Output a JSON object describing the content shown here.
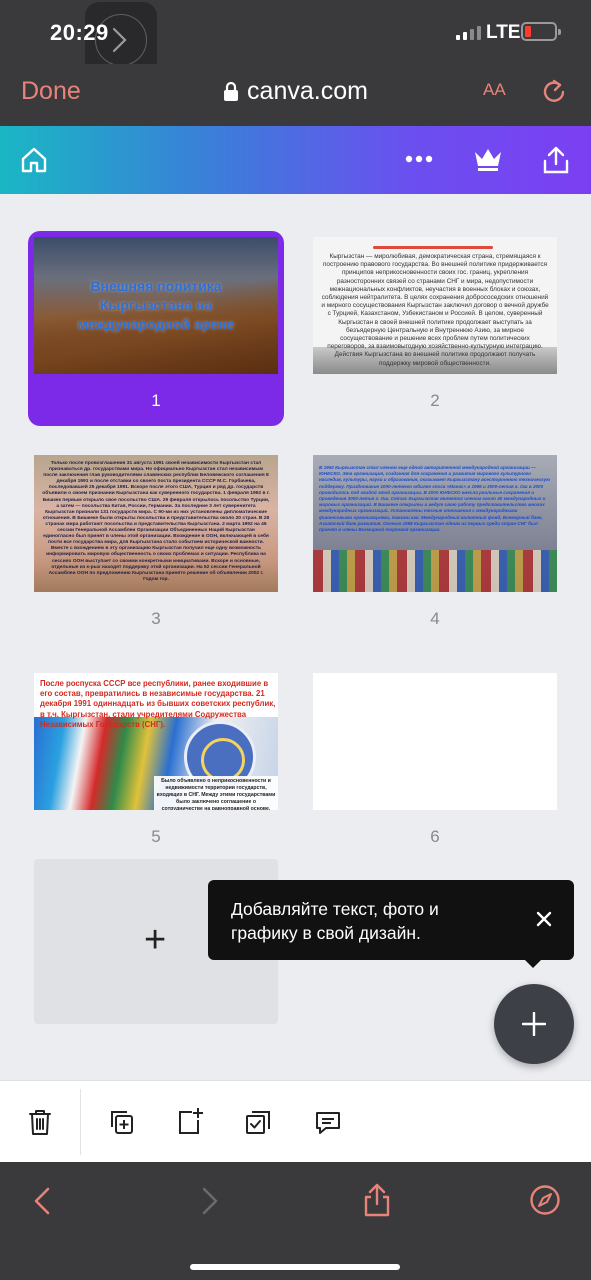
{
  "status_bar": {
    "time": "20:29",
    "network": "LTE"
  },
  "browser": {
    "done_label": "Done",
    "url": "canva.com",
    "text_size_label": "AA"
  },
  "canva_header": {
    "icons": [
      "home-icon",
      "more-icon",
      "crown-icon",
      "share-icon"
    ]
  },
  "pages": [
    {
      "number": "1",
      "selected": true,
      "title": "Внешняя политика Кыргызстана на международной арене"
    },
    {
      "number": "2",
      "selected": false,
      "text": "Кыргызстан — миролюбивая, демократическая страна, стремящаяся к построению правового государства. Во внешней политике придерживается принципов неприкосновенности своих гос. границ, укрепления разносторонних связей со странами СНГ и мира, недопустимости межнациональных конфликтов, неучастия в военных блоках и союзах, соблюдения нейтралитета. В целях сохранения добрососедских отношений и мирного сосуществования Кыргызстан заключил договор о вечной дружбе с Турцией, Казахстаном, Узбекистаном и Россией. В целом, суверенный Кыргызстан в своей внешней политике продолжает выступать за безъядерную Центральную и Внутреннюю Азию, за мирное сосуществование и решение всех проблем путем политических переговоров, за взаимовыгодную хозяйственно-культурную интеграцию. Действия Кыргызстана во внешней политике продолжают получать поддержку мировой общественности."
    },
    {
      "number": "3",
      "selected": false,
      "text": "Только после провозглашения 31 августа 1991 своей независимости Кыргызстан стал признаваться др. государствами мира. Но официально Кыргызстан стал независимым после заключения глав руководителями славянских республик Беловежского соглашения 8 декабря 1991 и после отставки со своего поста президента СССР М.С. Горбачева, последовавшей 25 декабря 1991. Вскоре после этого США, Турция и ряд др. государств объявили о своем признании Кыргызстана как суверенного государства. 1 февраля 1992 в г. Бишкек первым открыло свое посольство США. 29 февраля открылось посольство Турции, а затем — посольства Китая, России, Германии. За последние 3 лет суверенитета Кыргызстан признали 131 государств мира. С 90-ми из них установлены дипломатические отношения. В Бишкеке были открыты посольства и представительства около 20 стран. В 28 странах мира работают посольства и представительства Кыргызстана. 2 марта 1992 на 46 сессии Генеральной Ассамблеи Организации Объединенных Наций Кыргызстан единогласно был принят в члены этой организации. Вхождение в ООН, включающей в себя почти все государства мира, для Кыргызстана стало событием исторической важности. Вместе с вхождением в эту организацию Кыргызстан получил еще одну возможность информировать мировую общественность о своих проблемах и ситуации. Республика на сессиях ООН выступает со своими конкретными инициативами. Вскоре и основные, отдельные из к-рых находят поддержку этой организации. На 52 сессии Генеральной Ассамблеи ООН по предложению Кыргызстана принято решение об объявлении 2002 г. Годом гор."
    },
    {
      "number": "4",
      "selected": false,
      "text": "В 1992 Кыргызстан стал членом еще одной авторитетной международной организации — ЮНЕСКО. Эта организация, созданная для сохранения и развития мирового культурного наследия, культуры, науки и образования, оказывает Кыргызстану всестороннюю техническую поддержку. Празднование 1000-летнего юбилея эпоса «Манас» в 1995 и 3000-летия г. Ош в 2000 проводилось под эгидой этой организации. В 2000 ЮНЕСКО внесла реальные сохранения и проведения 3000-летия г. Ош. Сейчас Кыргызстан является членом около 40 международных и мировых организаций. В Бишкеке открыты и ведут свою работу представительства многих международных организаций. Установлены тесные отношения с международными финансовыми организациями, такими как: Международный валютный фонд, Всемирный банк, Азиатский банк развития. Осенью 1998 Кыргызстан одним из первых среди стран СНГ был принят в члены Всемирной торговой организации."
    },
    {
      "number": "5",
      "selected": false,
      "text": "После роспуска СССР все республики, ранее входившие в его состав, превратились в независимые государства. 21 декабря 1991 одиннадцать из бывших советских республик, в т.ч. Кыргызстан, стали учредителями Содружества Независимых Государств (СНГ).",
      "note": "Было объявлено о неприкосновенности и недвижимости территории государств, входящих в СНГ. Между этими государствами было заключено соглашение о сотрудничестве на равноправной основе."
    },
    {
      "number": "6",
      "selected": false
    }
  ],
  "add_page": {
    "label": "+"
  },
  "tooltip": {
    "text": "Добавляйте текст, фото и графику в свой дизайн."
  },
  "toolbar": {
    "icons": [
      "trash-icon",
      "duplicate-page-icon",
      "add-page-icon",
      "select-pages-icon",
      "comment-icon"
    ]
  },
  "colors": {
    "accent_purple": "#7d2ae8",
    "header_gradient_start": "#1ab7c4",
    "header_gradient_end": "#7b3ff2",
    "safari_accent": "#e8837a"
  }
}
